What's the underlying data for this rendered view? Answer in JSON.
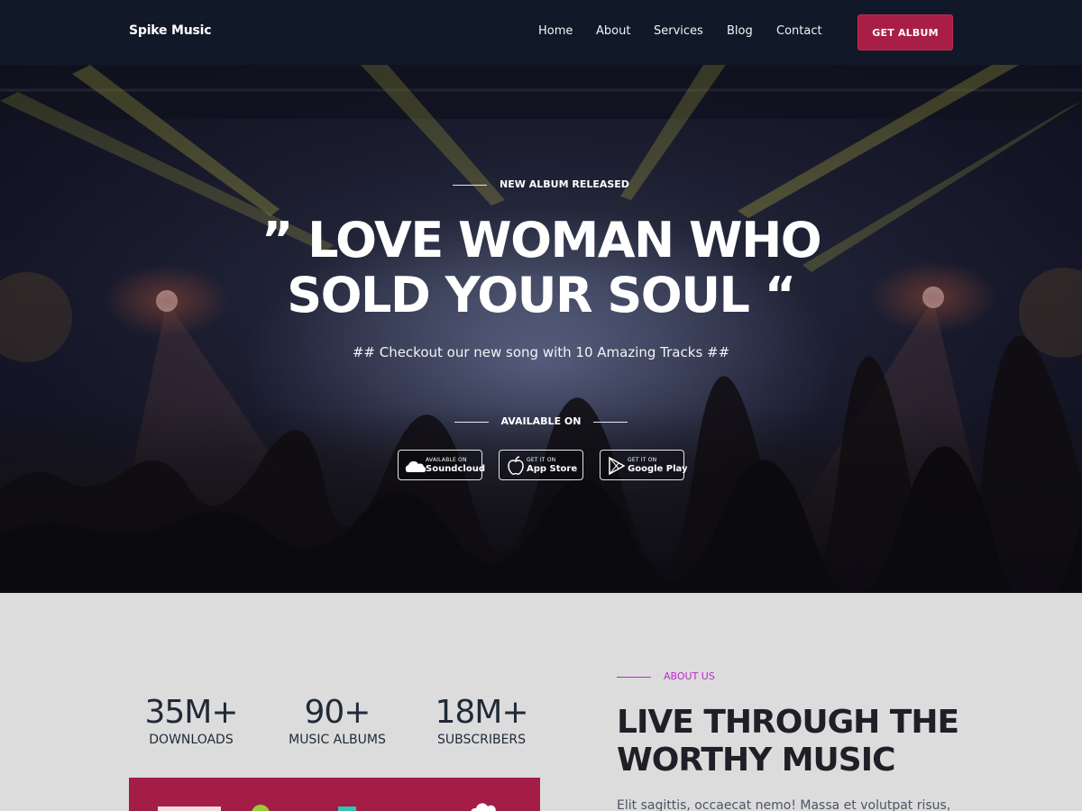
{
  "navbar": {
    "brand": "Spike Music",
    "links": [
      "Home",
      "About",
      "Services",
      "Blog",
      "Contact"
    ],
    "cta_label": "GET ALBUM"
  },
  "hero": {
    "eyebrow": "NEW ALBUM RELEASED",
    "title_line1": "” LOVE WOMAN WHO",
    "title_line2": "SOLD YOUR SOUL “",
    "subtitle": "## Checkout our new song with 10 Amazing Tracks ##",
    "available_label": "AVAILABLE ON",
    "stores": [
      {
        "small": "AVAILABLE ON",
        "big": "Soundcloud",
        "icon": "soundcloud-icon"
      },
      {
        "small": "GET IT ON",
        "big": "App Store",
        "icon": "apple-icon"
      },
      {
        "small": "GET IT ON",
        "big": "Google Play",
        "icon": "google-play-icon"
      }
    ]
  },
  "stats": [
    {
      "value": "35M+",
      "label": "DOWNLOADS"
    },
    {
      "value": "90+",
      "label": "MUSIC ALBUMS"
    },
    {
      "value": "18M+",
      "label": "SUBSCRIBERS"
    }
  ],
  "about": {
    "eyebrow": "ABOUT US",
    "title": "LIVE THROUGH THE WORTHY MUSIC",
    "text": "Elit sagittis, occaecat nemo! Massa et volutpat risus,"
  },
  "colors": {
    "nav_bg": "#111827",
    "accent": "#a91e45",
    "eyebrow_purple": "#c026d3",
    "section_bg": "#dcdcdc"
  }
}
